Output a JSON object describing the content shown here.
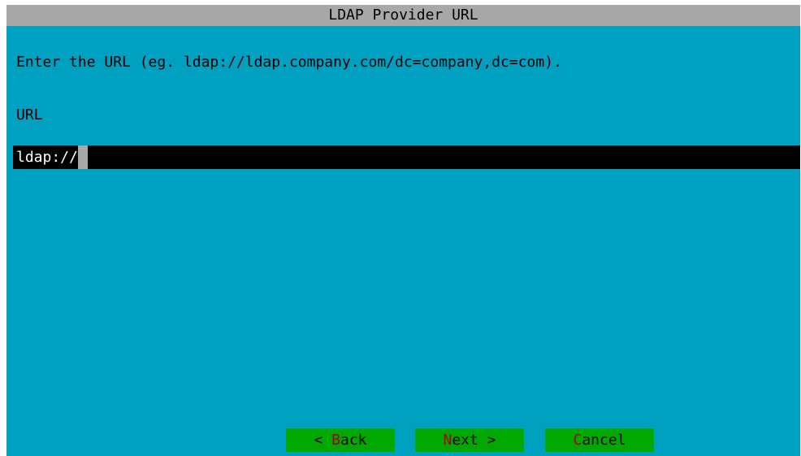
{
  "dialog": {
    "title": "LDAP Provider URL",
    "prompt": "Enter the URL (eg. ldap://ldap.company.com/dc=company,dc=com).",
    "field_label": "URL",
    "field_value": "ldap://"
  },
  "buttons": {
    "back": {
      "pre": "< ",
      "hotkey": "B",
      "post": "ack"
    },
    "next": {
      "pre": "",
      "hotkey": "N",
      "post": "ext >"
    },
    "cancel": {
      "pre": "",
      "hotkey": "C",
      "post": "ancel"
    }
  },
  "colors": {
    "background": "#00a0c0",
    "title_bar": "#a8a8a8",
    "input_background": "#000000",
    "input_text": "#ffffff",
    "cursor": "#a8a8a8",
    "button_background": "#00a800",
    "hotkey": "#a80000"
  }
}
